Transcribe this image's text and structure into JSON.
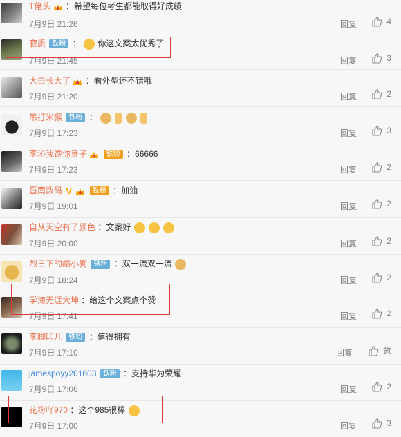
{
  "reply_label": "回复",
  "colors": {
    "username": "#eb7350",
    "link": "#2e7fd8",
    "highlight_box": "#e03a3a",
    "badge_fan": "#6bafd8"
  },
  "comments": [
    {
      "user": "T佬头",
      "badge": "",
      "text": "：希望每位考生都能取得好成绩",
      "time": "7月9日 21:26",
      "likes": "4"
    },
    {
      "user": "寂质",
      "badge": "铁粉",
      "text": "你这文案太优秀了",
      "time": "7月9日 21:45",
      "likes": "3"
    },
    {
      "user": "大白长大了",
      "badge": "",
      "text": "：看外型还不错哦",
      "time": "7月9日 21:20",
      "likes": "2"
    },
    {
      "user": "吊打米猴",
      "badge": "铁粉",
      "text": "：",
      "time": "7月9日 17:23",
      "likes": "3"
    },
    {
      "user": "李沁我馋你身子",
      "badge": "铁粉",
      "text": "：66666",
      "time": "7月9日 17:23",
      "likes": "2"
    },
    {
      "user": "暨南数码",
      "badge": "铁粉",
      "text": "：加油",
      "time": "7月9日 19:01",
      "likes": "2"
    },
    {
      "user": "自从天空有了颜色",
      "badge": "",
      "text": "：文案好",
      "time": "7月9日 20:00",
      "likes": "2"
    },
    {
      "user": "烈日下的酷小狗",
      "badge": "铁粉",
      "text": "：双一流双一流",
      "time": "7月9日 18:24",
      "likes": "2"
    },
    {
      "user": "学海无涯大坤",
      "badge": "",
      "text": "：给这个文案点个赞",
      "time": "7月9日 17:41",
      "likes": "2"
    },
    {
      "user": "李脚印儿",
      "badge": "铁粉",
      "text": "：值得拥有",
      "time": "7月9日 17:10",
      "likes": "赞"
    },
    {
      "user": "jamespoyy201603",
      "badge": "铁粉",
      "text": "：支持华为荣耀",
      "time": "7月9日 17:06",
      "likes": "2"
    },
    {
      "user": "花粉吖970",
      "badge": "",
      "text": "：这个985很棒",
      "time": "7月9日 17:00",
      "likes": "3"
    }
  ]
}
